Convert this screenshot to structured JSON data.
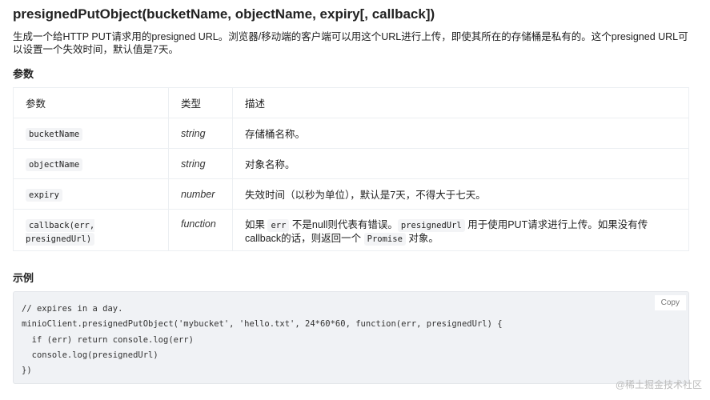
{
  "title": "presignedPutObject(bucketName, objectName, expiry[, callback])",
  "intro": "生成一个给HTTP PUT请求用的presigned URL。浏览器/移动端的客户端可以用这个URL进行上传，即使其所在的存储桶是私有的。这个presigned URL可以设置一个失效时间，默认值是7天。",
  "params_heading": "参数",
  "table": {
    "headers": [
      "参数",
      "类型",
      "描述"
    ],
    "rows": [
      {
        "param": "bucketName",
        "type": "string",
        "desc": "存储桶名称。"
      },
      {
        "param": "objectName",
        "type": "string",
        "desc": "对象名称。"
      },
      {
        "param": "expiry",
        "type": "number",
        "desc": "失效时间（以秒为单位），默认是7天，不得大于七天。"
      },
      {
        "param": "callback(err, presignedUrl)",
        "type": "function",
        "desc_parts": [
          "如果 ",
          "err",
          " 不是null则代表有错误。",
          "presignedUrl",
          " 用于使用PUT请求进行上传。如果没有传callback的话，则返回一个 ",
          "Promise",
          " 对象。"
        ]
      }
    ]
  },
  "example_heading": "示例",
  "code_lines": [
    "// expires in a day.",
    "minioClient.presignedPutObject('mybucket', 'hello.txt', 24*60*60, function(err, presignedUrl) {",
    "  if (err) return console.log(err)",
    "  console.log(presignedUrl)",
    "})"
  ],
  "copy_label": "Copy",
  "watermark": "@稀土掘金技术社区"
}
